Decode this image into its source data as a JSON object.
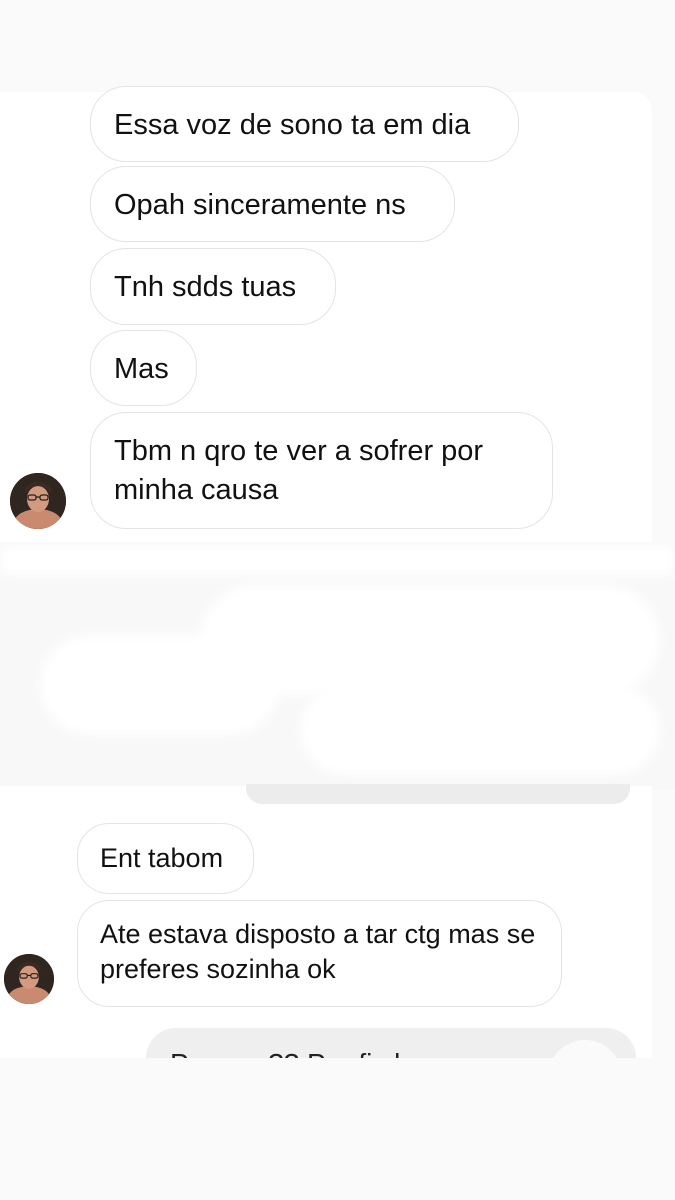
{
  "chat": {
    "top_messages": [
      {
        "text": "Essa voz de sono ta em dia"
      },
      {
        "text": "Opah sinceramente ns"
      },
      {
        "text": "Tnh sdds tuas"
      },
      {
        "text": "Mas"
      },
      {
        "text": "Tbm n qro te ver a sofrer por minha causa"
      }
    ],
    "bottom_messages": [
      {
        "text": "Ent tabom"
      },
      {
        "text": "Ate estava disposto a tar ctg mas se preferes sozinha ok"
      }
    ],
    "partial_sent_message": "Porque ?? Pra fic l",
    "colors": {
      "background": "#fafafa",
      "bubble_background": "#ffffff",
      "bubble_border": "#e4e4e4",
      "sent_bubble": "#efefef",
      "text": "#111111"
    },
    "avatar_icon": "profile-avatar"
  }
}
